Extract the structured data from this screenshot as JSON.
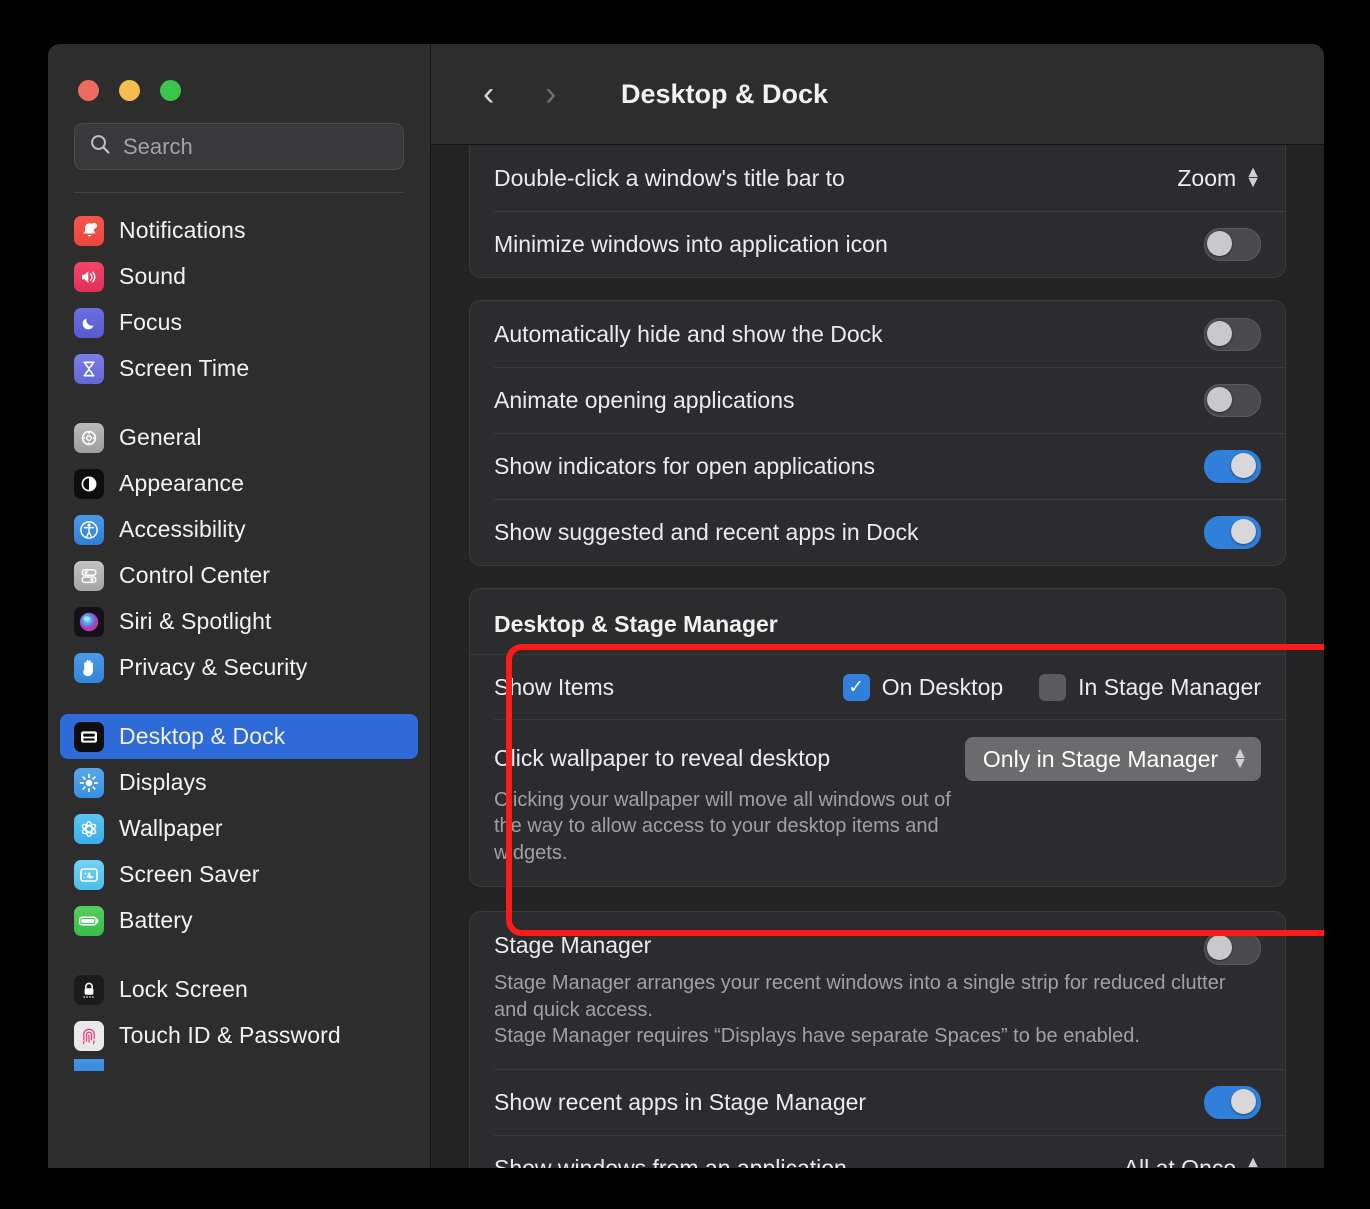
{
  "window": {
    "traffic_lights": [
      "close",
      "minimize",
      "zoom"
    ],
    "colors": {
      "accent": "#2f7fdb",
      "selected_sidebar": "#2f6bd8",
      "highlight_border": "#fc1a1a"
    }
  },
  "sidebar": {
    "search": {
      "placeholder": "Search",
      "icon": "search-icon"
    },
    "groups": [
      {
        "items": [
          {
            "label": "Notifications",
            "icon": "notifications-icon"
          },
          {
            "label": "Sound",
            "icon": "sound-icon"
          },
          {
            "label": "Focus",
            "icon": "focus-icon"
          },
          {
            "label": "Screen Time",
            "icon": "screen-time-icon"
          }
        ]
      },
      {
        "items": [
          {
            "label": "General",
            "icon": "general-icon"
          },
          {
            "label": "Appearance",
            "icon": "appearance-icon"
          },
          {
            "label": "Accessibility",
            "icon": "accessibility-icon"
          },
          {
            "label": "Control Center",
            "icon": "control-center-icon"
          },
          {
            "label": "Siri & Spotlight",
            "icon": "siri-spotlight-icon"
          },
          {
            "label": "Privacy & Security",
            "icon": "privacy-security-icon"
          }
        ]
      },
      {
        "items": [
          {
            "label": "Desktop & Dock",
            "icon": "desktop-dock-icon",
            "selected": true
          },
          {
            "label": "Displays",
            "icon": "displays-icon"
          },
          {
            "label": "Wallpaper",
            "icon": "wallpaper-icon"
          },
          {
            "label": "Screen Saver",
            "icon": "screen-saver-icon"
          },
          {
            "label": "Battery",
            "icon": "battery-icon"
          }
        ]
      },
      {
        "items": [
          {
            "label": "Lock Screen",
            "icon": "lock-screen-icon"
          },
          {
            "label": "Touch ID & Password",
            "icon": "touch-id-icon"
          }
        ]
      }
    ]
  },
  "titlebar": {
    "back": "‹",
    "forward": "›",
    "title": "Desktop & Dock"
  },
  "content": {
    "card_windows": {
      "rows": [
        {
          "label": "Double-click a window's title bar to",
          "control": "popup-plain",
          "value": "Zoom"
        },
        {
          "label": "Minimize windows into application icon",
          "control": "toggle",
          "value": "off"
        }
      ]
    },
    "card_dock": {
      "rows": [
        {
          "label": "Automatically hide and show the Dock",
          "control": "toggle",
          "value": "off"
        },
        {
          "label": "Animate opening applications",
          "control": "toggle",
          "value": "off"
        },
        {
          "label": "Show indicators for open applications",
          "control": "toggle",
          "value": "on"
        },
        {
          "label": "Show suggested and recent apps in Dock",
          "control": "toggle",
          "value": "on"
        }
      ]
    },
    "card_stage_desktop": {
      "heading": "Desktop & Stage Manager",
      "highlighted": true,
      "show_items": {
        "label": "Show Items",
        "checkboxes": [
          {
            "label": "On Desktop",
            "checked": true
          },
          {
            "label": "In Stage Manager",
            "checked": false
          }
        ]
      },
      "click_wallpaper": {
        "label": "Click wallpaper to reveal desktop",
        "value": "Only in Stage Manager",
        "description": "Clicking your wallpaper will move all windows out of the way to allow access to your desktop items and widgets."
      }
    },
    "card_stage_manager": {
      "title": "Stage Manager",
      "toggle": "off",
      "description_line1": "Stage Manager arranges your recent windows into a single strip for reduced clutter and quick access.",
      "description_line2": "Stage Manager requires “Displays have separate Spaces” to be enabled.",
      "rows": [
        {
          "label": "Show recent apps in Stage Manager",
          "control": "toggle",
          "value": "on"
        },
        {
          "label": "Show windows from an application",
          "control": "popup-plain",
          "value": "All at Once"
        }
      ]
    }
  }
}
